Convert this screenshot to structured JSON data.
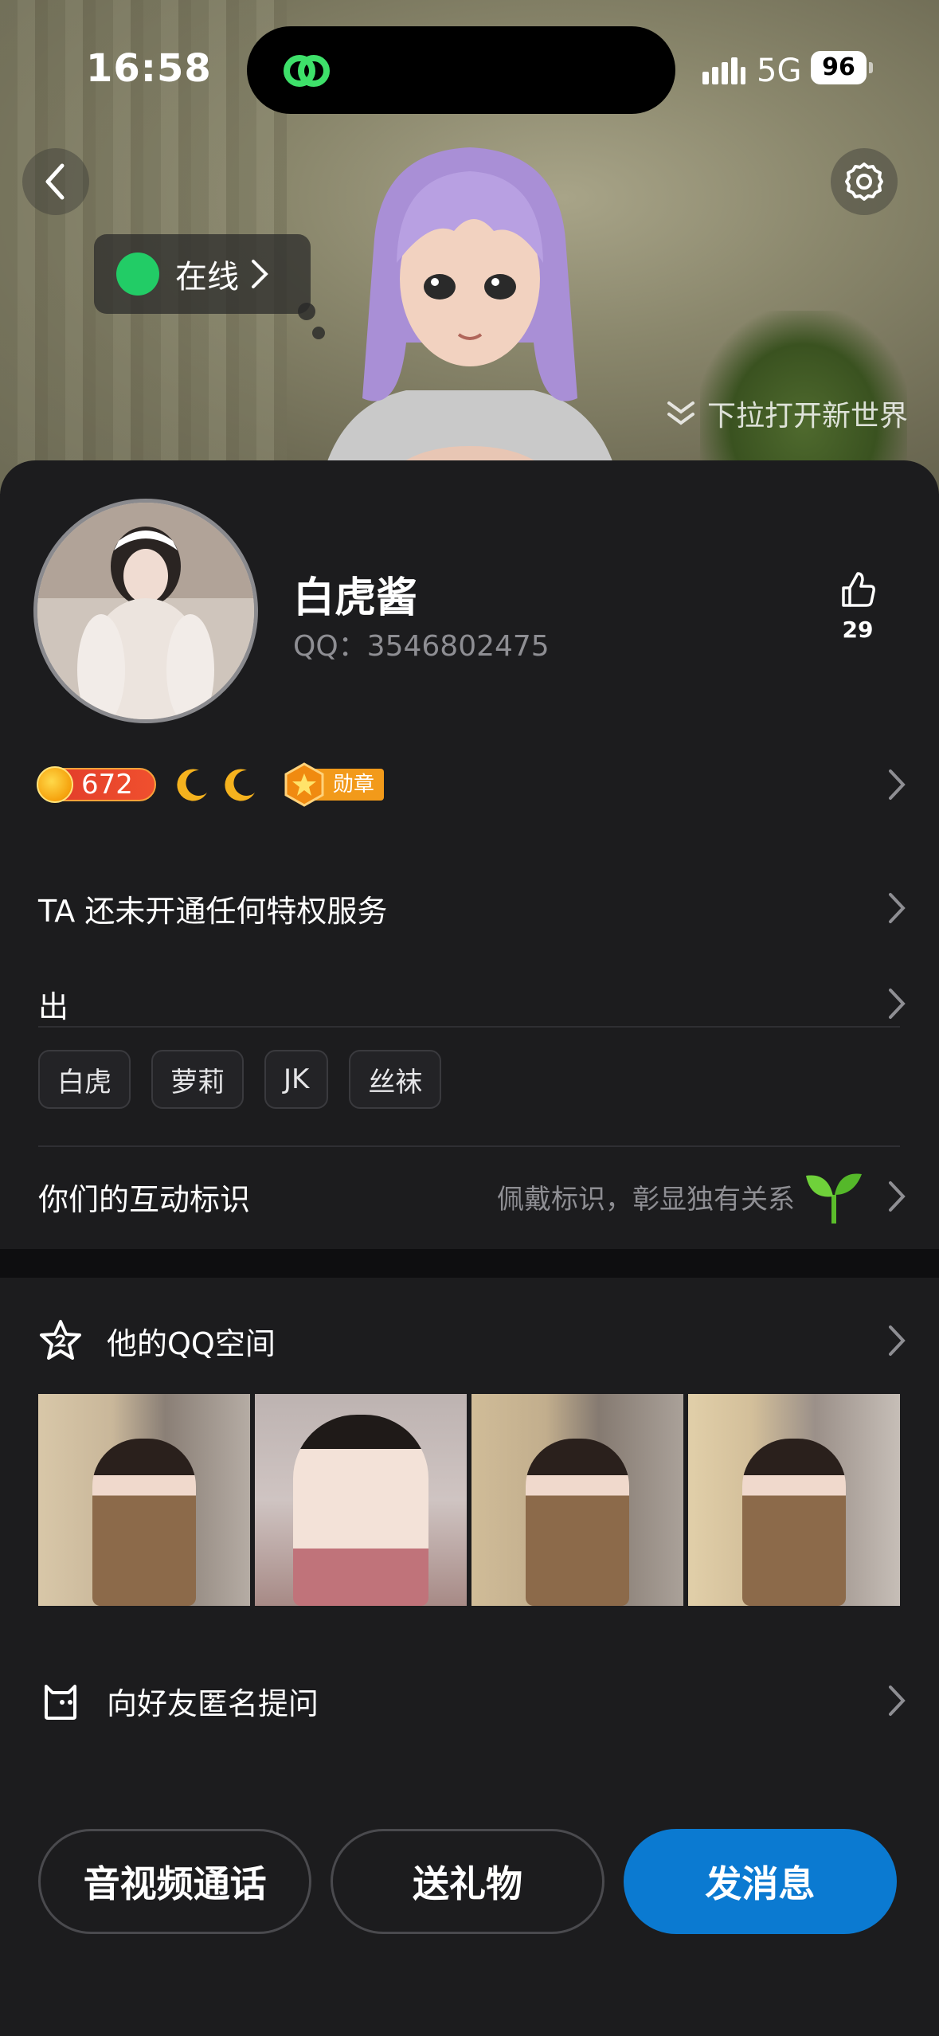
{
  "status_bar": {
    "time": "16:58",
    "network": "5G",
    "battery": "96"
  },
  "hero": {
    "online_status": "在线",
    "pull_hint": "下拉打开新世界",
    "online_color": "#22cc66"
  },
  "profile": {
    "name": "白虎酱",
    "qq_label": "QQ：3546802475",
    "likes": "29",
    "level": "672",
    "medal_label": "勋章"
  },
  "rows": {
    "privilege": "TA 还未开通任何特权服务",
    "signature": "出"
  },
  "tags": [
    "白虎",
    "萝莉",
    "JK",
    "丝袜"
  ],
  "interaction": {
    "label": "你们的互动标识",
    "hint": "佩戴标识，彰显独有关系"
  },
  "qzone": {
    "label": "他的QQ空间"
  },
  "ask": {
    "label": "向好友匿名提问"
  },
  "actions": {
    "call": "音视频通话",
    "gift": "送礼物",
    "message": "发消息"
  },
  "colors": {
    "accent": "#0b7ad1",
    "background": "#1c1c1e"
  }
}
